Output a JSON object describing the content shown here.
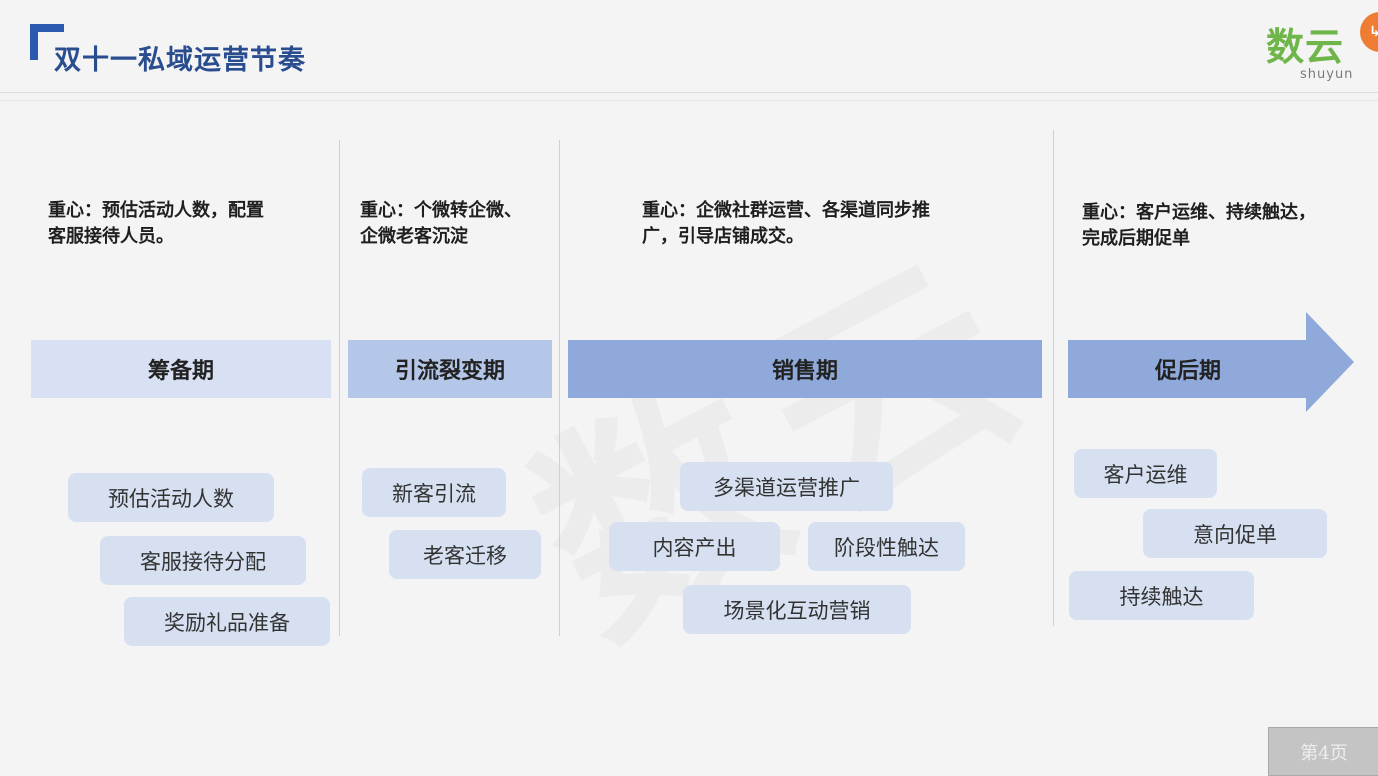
{
  "header": {
    "title": "双十一私域运营节奏",
    "logo_cn": "数云",
    "logo_en": "shuyun"
  },
  "watermark": "数云",
  "phases": [
    {
      "focus_line1": "重心：预估活动人数，配置",
      "focus_line2": "客服接待人员。",
      "name": "筹备期",
      "band_color": "#d7e1f3"
    },
    {
      "focus_line1": "重心：个微转企微、",
      "focus_line2": "企微老客沉淀",
      "name": "引流裂变期",
      "band_color": "#b5c7e8"
    },
    {
      "focus_line1": "重心：企微社群运营、各渠道同步推",
      "focus_line2": "广，引导店铺成交。",
      "name": "销售期",
      "band_color": "#8ea9da"
    },
    {
      "focus_line1": "重心：客户运维、持续触达，",
      "focus_line2": "完成后期促单",
      "name": "促后期",
      "band_color": "#8ea9da"
    }
  ],
  "tasks": {
    "prep": [
      "预估活动人数",
      "客服接待分配",
      "奖励礼品准备"
    ],
    "traffic": [
      "新客引流",
      "老客迁移"
    ],
    "sales": [
      "多渠道运营推广",
      "内容产出",
      "阶段性触达",
      "场景化互动营销"
    ],
    "post": [
      "客户运维",
      "意向促单",
      "持续触达"
    ]
  },
  "footer": {
    "page_label": "第4页"
  }
}
